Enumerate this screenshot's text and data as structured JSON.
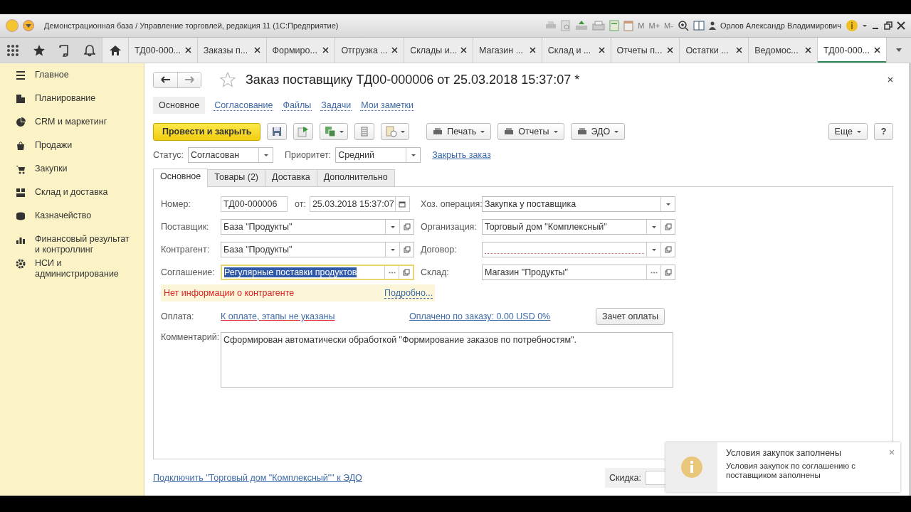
{
  "window": {
    "title": "Демонстрационная база / Управление торговлей, редакция 11  (1С:Предприятие)",
    "memory_buttons": [
      "M",
      "M+",
      "M-"
    ],
    "user": "Орлов Александр Владимирович"
  },
  "tabs": [
    {
      "label": "ТД00-000...",
      "selected": false
    },
    {
      "label": "Заказы п...",
      "selected": false
    },
    {
      "label": "Формиро...",
      "selected": false
    },
    {
      "label": "Отгрузка ...",
      "selected": false
    },
    {
      "label": "Склады и...",
      "selected": false
    },
    {
      "label": "Магазин ...",
      "selected": false
    },
    {
      "label": "Склад и ...",
      "selected": false
    },
    {
      "label": "Отчеты п...",
      "selected": false
    },
    {
      "label": "Остатки ...",
      "selected": false
    },
    {
      "label": "Ведомос...",
      "selected": false
    },
    {
      "label": "ТД00-000...",
      "selected": true
    }
  ],
  "sidebar": {
    "items": [
      {
        "label": "Главное"
      },
      {
        "label": "Планирование"
      },
      {
        "label": "CRM и маркетинг"
      },
      {
        "label": "Продажи"
      },
      {
        "label": "Закупки"
      },
      {
        "label": "Склад и доставка"
      },
      {
        "label": "Казначейство"
      },
      {
        "label": "Финансовый результат и контроллинг"
      },
      {
        "label": "НСИ и администрирование"
      }
    ]
  },
  "form": {
    "title": "Заказ поставщику ТД00-000006 от 25.03.2018 15:37:07 *",
    "nav_links": [
      {
        "label": "Основное",
        "selected": true
      },
      {
        "label": "Согласование",
        "selected": false
      },
      {
        "label": "Файлы",
        "selected": false
      },
      {
        "label": "Задачи",
        "selected": false
      },
      {
        "label": "Мои заметки",
        "selected": false
      }
    ],
    "primary_button": "Провести и закрыть",
    "menu_buttons": [
      {
        "label": "Печать"
      },
      {
        "label": "Отчеты"
      },
      {
        "label": "ЭДО"
      }
    ],
    "more_button": "Еще",
    "help_button": "?",
    "status": {
      "label": "Статус:",
      "value": "Согласован"
    },
    "priority": {
      "label": "Приоритет:",
      "value": "Средний"
    },
    "close_link": "Закрыть заказ",
    "tabs": [
      {
        "label": "Основное",
        "selected": true
      },
      {
        "label": "Товары (2)",
        "selected": false
      },
      {
        "label": "Доставка",
        "selected": false
      },
      {
        "label": "Дополнительно",
        "selected": false
      }
    ],
    "number": {
      "label": "Номер:",
      "value": "ТД00-000006"
    },
    "date": {
      "label": "от:",
      "value": "25.03.2018 15:37:07"
    },
    "left_fields": [
      {
        "label": "Поставщик:",
        "value": "База \"Продукты\"",
        "kind": "select",
        "focused": false
      },
      {
        "label": "Контрагент:",
        "value": "База \"Продукты\"",
        "kind": "select",
        "focused": false
      },
      {
        "label": "Соглашение:",
        "value": "Регулярные поставки продуктов",
        "kind": "choice",
        "focused": true
      }
    ],
    "right_fields": [
      {
        "label": "Хоз. операция:",
        "value": "Закупка у поставщика",
        "kind": "dropdown",
        "focused": false
      },
      {
        "label": "Организация:",
        "value": "Торговый дом \"Комплексный\"",
        "kind": "select",
        "focused": false
      },
      {
        "label": "Договор:",
        "kind": "select",
        "focused": false
      },
      {
        "label": "Склад:",
        "value": "Магазин \"Продукты\"",
        "kind": "choice",
        "focused": false
      }
    ],
    "warning": {
      "text": "Нет информации о контрагенте",
      "link": "Подробно..."
    },
    "payment": {
      "label": "Оплата:",
      "link": "К оплате, этапы не указаны",
      "paid_link": "Оплачено по заказу: 0.00 USD  0%",
      "button": "Зачет оплаты"
    },
    "comment": {
      "label": "Комментарий:",
      "value": "Сформирован автоматически обработкой \"Формирование заказов по потребностям\"."
    },
    "footer_link": "Подключить \"Торговый дом \"Комплексный\"\" к ЭДО",
    "discount_label": "Скидка:"
  },
  "notification": {
    "title": "Условия закупок заполнены",
    "text": "Условия закупок по соглашению с поставщиком заполнены"
  }
}
